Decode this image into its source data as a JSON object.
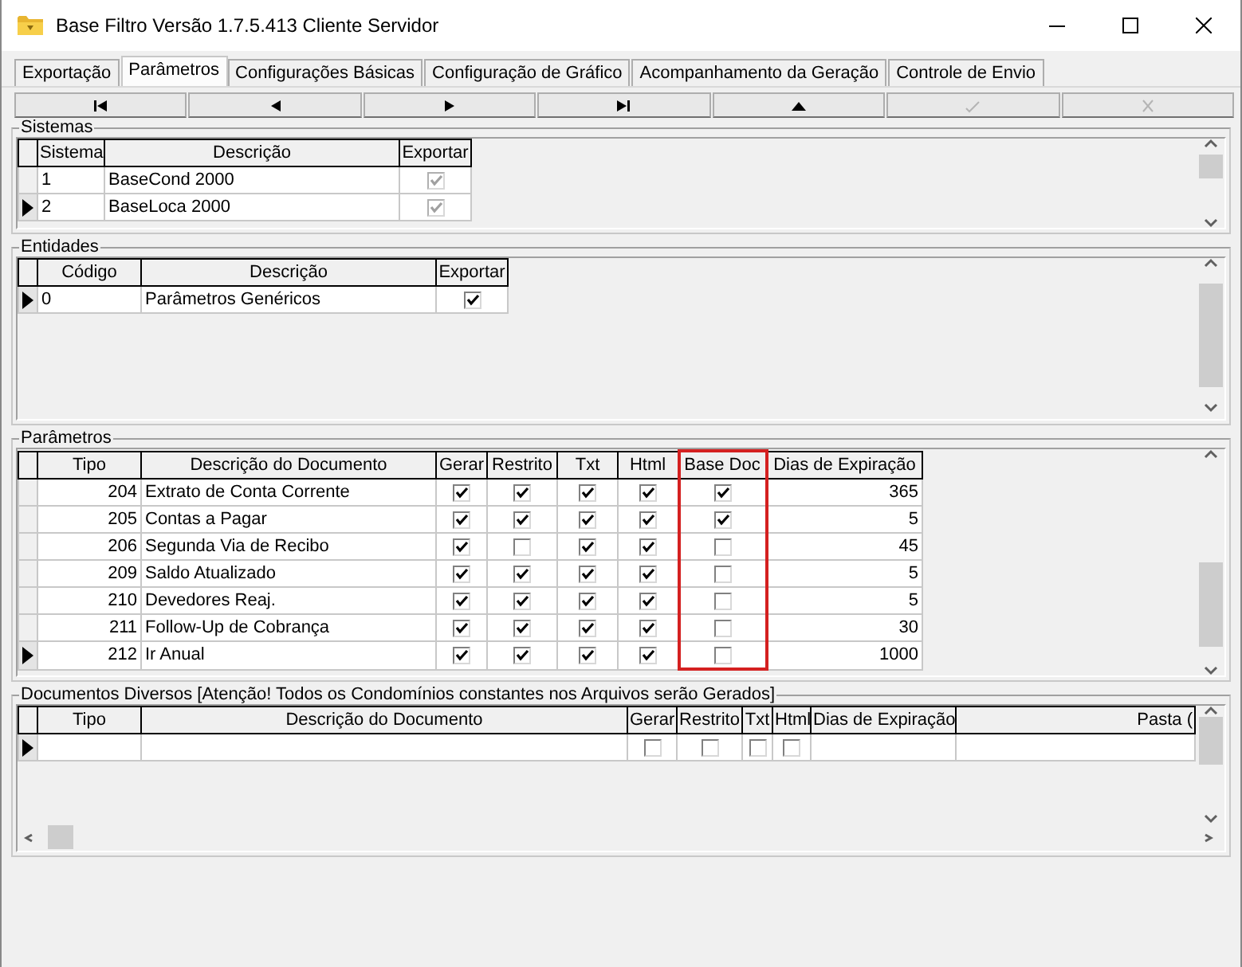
{
  "window": {
    "title": "Base Filtro Versão 1.7.5.413 Cliente Servidor"
  },
  "tabs": [
    {
      "label": "Exportação",
      "selected": false
    },
    {
      "label": "Parâmetros",
      "selected": true
    },
    {
      "label": "Configurações Básicas",
      "selected": false
    },
    {
      "label": "Configuração de Gráfico",
      "selected": false
    },
    {
      "label": "Acompanhamento da Geração",
      "selected": false
    },
    {
      "label": "Controle de Envio",
      "selected": false
    }
  ],
  "navigator": [
    {
      "kind": "first",
      "disabled": false
    },
    {
      "kind": "prior",
      "disabled": false
    },
    {
      "kind": "next",
      "disabled": false
    },
    {
      "kind": "last",
      "disabled": false
    },
    {
      "kind": "insert",
      "disabled": false
    },
    {
      "kind": "post",
      "disabled": true
    },
    {
      "kind": "cancel",
      "disabled": true
    }
  ],
  "groups": [
    {
      "title": "Sistemas",
      "columns": [
        {
          "label": "Sistema",
          "kind": "text"
        },
        {
          "label": "Descrição",
          "kind": "text"
        },
        {
          "label": "Exportar",
          "kind": "check"
        }
      ],
      "rows": [
        {
          "current": false,
          "cells": [
            "1",
            "BaseCond 2000",
            {
              "checked": true,
              "disabled": true
            }
          ]
        },
        {
          "current": true,
          "cells": [
            "2",
            "BaseLoca 2000",
            {
              "checked": true,
              "disabled": true
            }
          ]
        }
      ]
    },
    {
      "title": "Entidades",
      "columns": [
        {
          "label": "Código",
          "kind": "text"
        },
        {
          "label": "Descrição",
          "kind": "text"
        },
        {
          "label": "Exportar",
          "kind": "check"
        }
      ],
      "rows": [
        {
          "current": true,
          "cells": [
            "0",
            "Parâmetros Genéricos",
            {
              "checked": true,
              "disabled": false
            }
          ]
        }
      ]
    },
    {
      "title": "Parâmetros",
      "columns": [
        {
          "label": "Tipo",
          "kind": "number"
        },
        {
          "label": "Descrição do Documento",
          "kind": "text"
        },
        {
          "label": "Gerar",
          "kind": "check"
        },
        {
          "label": "Restrito",
          "kind": "check"
        },
        {
          "label": "Txt",
          "kind": "check"
        },
        {
          "label": "Html",
          "kind": "check"
        },
        {
          "label": "Base Doc",
          "kind": "check",
          "highlighted": true
        },
        {
          "label": "Dias de Expiração",
          "kind": "number"
        }
      ],
      "rows": [
        {
          "current": false,
          "cells": [
            "204",
            "Extrato de Conta Corrente",
            {
              "checked": true
            },
            {
              "checked": true
            },
            {
              "checked": true
            },
            {
              "checked": true
            },
            {
              "checked": true
            },
            "365"
          ]
        },
        {
          "current": false,
          "cells": [
            "205",
            "Contas a Pagar",
            {
              "checked": true
            },
            {
              "checked": true
            },
            {
              "checked": true
            },
            {
              "checked": true
            },
            {
              "checked": true
            },
            "5"
          ]
        },
        {
          "current": false,
          "cells": [
            "206",
            "Segunda Via de Recibo",
            {
              "checked": true
            },
            {
              "checked": false
            },
            {
              "checked": true
            },
            {
              "checked": true
            },
            {
              "checked": false
            },
            "45"
          ]
        },
        {
          "current": false,
          "cells": [
            "209",
            "Saldo Atualizado",
            {
              "checked": true
            },
            {
              "checked": true
            },
            {
              "checked": true
            },
            {
              "checked": true
            },
            {
              "checked": false
            },
            "5"
          ]
        },
        {
          "current": false,
          "cells": [
            "210",
            "Devedores Reaj.",
            {
              "checked": true
            },
            {
              "checked": true
            },
            {
              "checked": true
            },
            {
              "checked": true
            },
            {
              "checked": false
            },
            "5"
          ]
        },
        {
          "current": false,
          "cells": [
            "211",
            "Follow-Up de Cobrança",
            {
              "checked": true
            },
            {
              "checked": true
            },
            {
              "checked": true
            },
            {
              "checked": true
            },
            {
              "checked": false
            },
            "30"
          ]
        },
        {
          "current": true,
          "cells": [
            "212",
            "Ir Anual",
            {
              "checked": true
            },
            {
              "checked": true
            },
            {
              "checked": true
            },
            {
              "checked": true
            },
            {
              "checked": false
            },
            "1000"
          ]
        }
      ]
    },
    {
      "title": "Documentos Diversos [Atenção! Todos os Condomínios constantes nos Arquivos serão Gerados]",
      "columns": [
        {
          "label": "Tipo",
          "kind": "number"
        },
        {
          "label": "Descrição do Documento",
          "kind": "text"
        },
        {
          "label": "Gerar",
          "kind": "check"
        },
        {
          "label": "Restrito",
          "kind": "check"
        },
        {
          "label": "Txt",
          "kind": "check"
        },
        {
          "label": "Html",
          "kind": "check"
        },
        {
          "label": "Dias de Expiração",
          "kind": "number"
        },
        {
          "label": "Pasta (",
          "kind": "text"
        }
      ],
      "rows": [
        {
          "current": true,
          "cells": [
            null,
            null,
            {
              "checked": false
            },
            {
              "checked": false
            },
            {
              "checked": false
            },
            {
              "checked": false
            },
            null,
            null
          ]
        }
      ]
    }
  ]
}
